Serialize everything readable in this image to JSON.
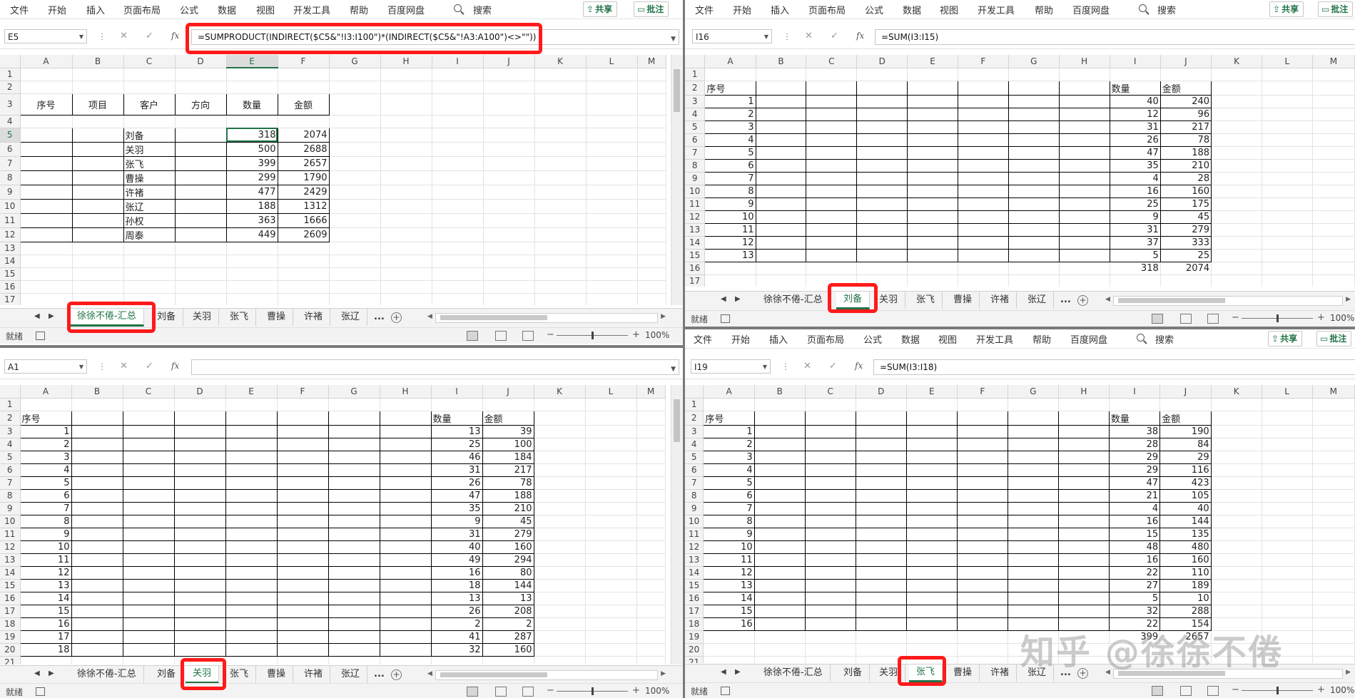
{
  "menu": [
    "文件",
    "开始",
    "插入",
    "页面布局",
    "公式",
    "数据",
    "视图",
    "开发工具",
    "帮助",
    "百度网盘"
  ],
  "search_label": "搜索",
  "share_label": "共享",
  "comment_label": "批注",
  "col_letters": [
    "A",
    "B",
    "C",
    "D",
    "E",
    "F",
    "G",
    "H",
    "I",
    "J",
    "K",
    "L",
    "M"
  ],
  "sheet_tabs": [
    "徐徐不倦-汇总",
    "刘备",
    "关羽",
    "张飞",
    "曹操",
    "许褚",
    "张辽"
  ],
  "more_tabs": "...",
  "status_text": "就绪",
  "zoom": "100%",
  "watermark": "知乎 @徐徐不倦",
  "windows": {
    "summary": {
      "name_box": "E5",
      "formula": "=SUMPRODUCT(INDIRECT($C5&\"!I3:I100\")*(INDIRECT($C5&\"!A3:A100\")<>\"\"))",
      "active_tab": "徐徐不倦-汇总",
      "headers": [
        "序号",
        "项目",
        "客户",
        "方向",
        "数量",
        "金额"
      ],
      "rows": [
        [
          "",
          "",
          "刘备",
          "",
          "318",
          "2074"
        ],
        [
          "",
          "",
          "关羽",
          "",
          "500",
          "2688"
        ],
        [
          "",
          "",
          "张飞",
          "",
          "399",
          "2657"
        ],
        [
          "",
          "",
          "曹操",
          "",
          "299",
          "1790"
        ],
        [
          "",
          "",
          "许褚",
          "",
          "477",
          "2429"
        ],
        [
          "",
          "",
          "张辽",
          "",
          "188",
          "1312"
        ],
        [
          "",
          "",
          "孙权",
          "",
          "363",
          "1666"
        ],
        [
          "",
          "",
          "周泰",
          "",
          "449",
          "2609"
        ]
      ]
    },
    "liubei": {
      "name_box": "I16",
      "formula": "=SUM(I3:I15)",
      "active_tab": "刘备",
      "header_a": "序号",
      "header_i": "数量",
      "header_j": "金额",
      "rows": [
        [
          "1",
          "40",
          "240"
        ],
        [
          "2",
          "12",
          "96"
        ],
        [
          "3",
          "31",
          "217"
        ],
        [
          "4",
          "26",
          "78"
        ],
        [
          "5",
          "47",
          "188"
        ],
        [
          "6",
          "35",
          "210"
        ],
        [
          "7",
          "4",
          "28"
        ],
        [
          "8",
          "16",
          "160"
        ],
        [
          "9",
          "25",
          "175"
        ],
        [
          "10",
          "9",
          "45"
        ],
        [
          "11",
          "31",
          "279"
        ],
        [
          "12",
          "37",
          "333"
        ],
        [
          "13",
          "5",
          "25"
        ]
      ],
      "total_i": "318",
      "total_j": "2074"
    },
    "guanyu": {
      "name_box": "A1",
      "formula": "",
      "active_tab": "关羽",
      "header_a": "序号",
      "header_i": "数量",
      "header_j": "金额",
      "rows": [
        [
          "1",
          "13",
          "39"
        ],
        [
          "2",
          "25",
          "100"
        ],
        [
          "3",
          "46",
          "184"
        ],
        [
          "4",
          "31",
          "217"
        ],
        [
          "5",
          "26",
          "78"
        ],
        [
          "6",
          "47",
          "188"
        ],
        [
          "7",
          "35",
          "210"
        ],
        [
          "8",
          "9",
          "45"
        ],
        [
          "9",
          "31",
          "279"
        ],
        [
          "10",
          "40",
          "160"
        ],
        [
          "11",
          "49",
          "294"
        ],
        [
          "12",
          "16",
          "80"
        ],
        [
          "13",
          "18",
          "144"
        ],
        [
          "14",
          "13",
          "13"
        ],
        [
          "15",
          "26",
          "208"
        ],
        [
          "16",
          "2",
          "2"
        ],
        [
          "17",
          "41",
          "287"
        ],
        [
          "18",
          "32",
          "160"
        ]
      ]
    },
    "zhangfei": {
      "name_box": "I19",
      "formula": "=SUM(I3:I18)",
      "active_tab": "张飞",
      "header_a": "序号",
      "header_i": "数量",
      "header_j": "金额",
      "rows": [
        [
          "1",
          "38",
          "190"
        ],
        [
          "2",
          "28",
          "84"
        ],
        [
          "3",
          "29",
          "29"
        ],
        [
          "4",
          "29",
          "116"
        ],
        [
          "5",
          "47",
          "423"
        ],
        [
          "6",
          "21",
          "105"
        ],
        [
          "7",
          "4",
          "40"
        ],
        [
          "8",
          "16",
          "144"
        ],
        [
          "9",
          "15",
          "135"
        ],
        [
          "10",
          "48",
          "480"
        ],
        [
          "11",
          "16",
          "160"
        ],
        [
          "12",
          "22",
          "110"
        ],
        [
          "13",
          "27",
          "189"
        ],
        [
          "14",
          "5",
          "10"
        ],
        [
          "15",
          "32",
          "288"
        ],
        [
          "16",
          "22",
          "154"
        ]
      ],
      "total_i": "399",
      "total_j": "2657"
    }
  },
  "colors": {
    "accent": "#217346",
    "highlight_red": "#ff1a1a"
  }
}
